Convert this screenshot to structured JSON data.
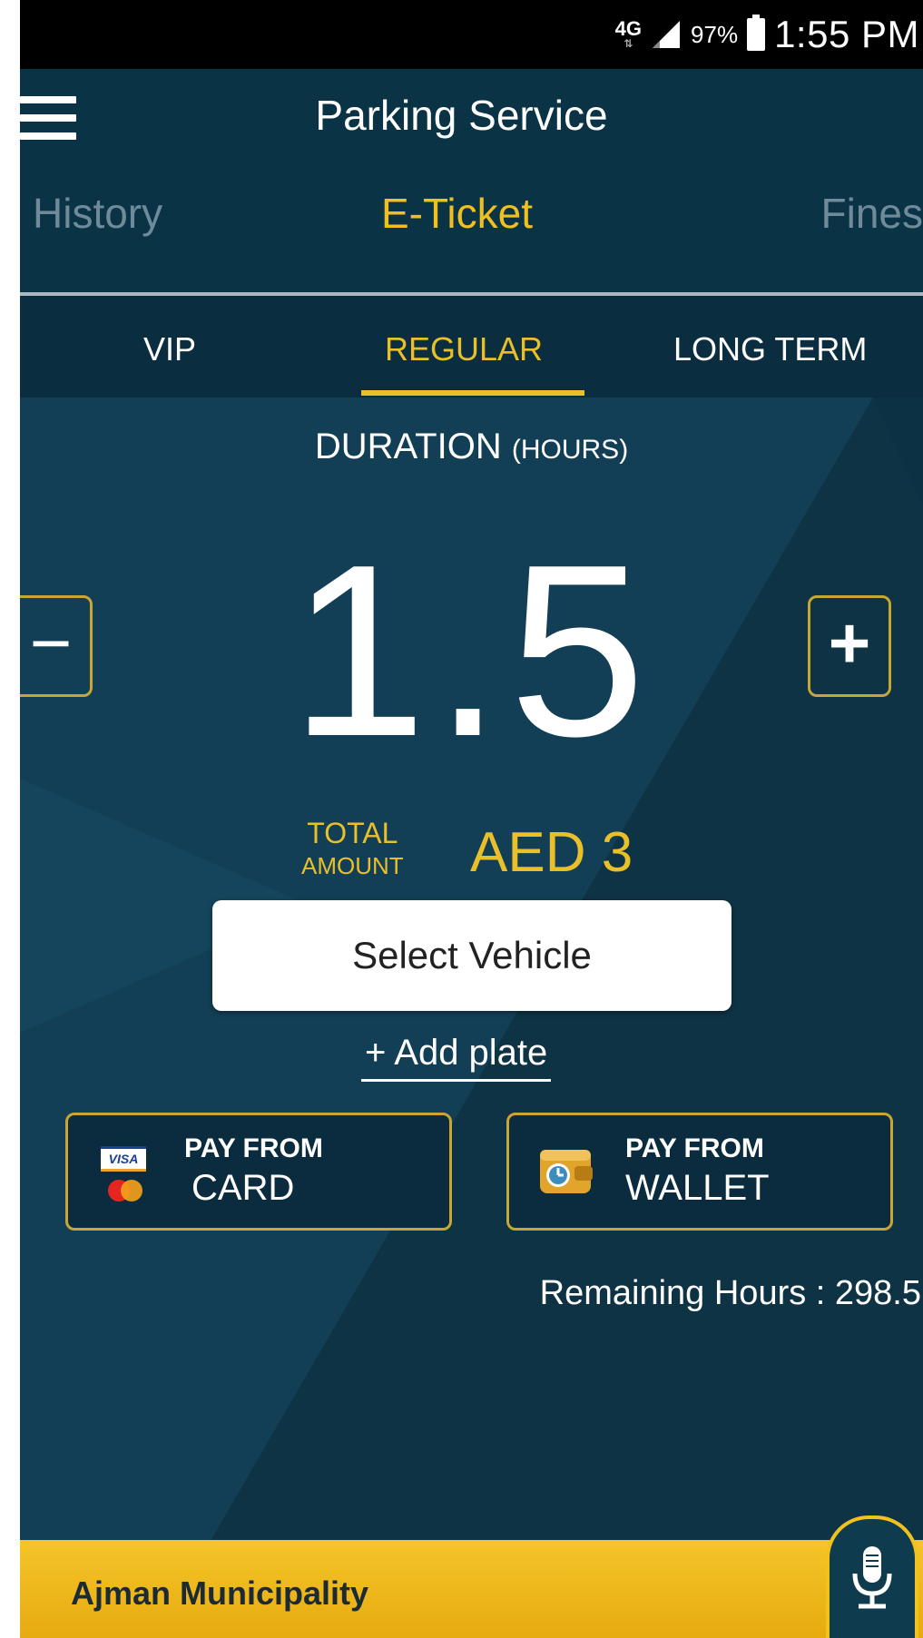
{
  "status_bar": {
    "network": "4G",
    "network_arrows": "⇅",
    "battery": "97%",
    "time": "1:55 PM"
  },
  "header": {
    "title": "Parking Service",
    "tabs": [
      {
        "label": "History",
        "active": false
      },
      {
        "label": "E-Ticket",
        "active": true
      },
      {
        "label": "Fines",
        "active": false
      }
    ]
  },
  "ticket_types": [
    {
      "label": "VIP",
      "active": false
    },
    {
      "label": "REGULAR",
      "active": true
    },
    {
      "label": "LONG TERM",
      "active": false
    }
  ],
  "duration": {
    "label": "DURATION",
    "unit": "(HOURS)",
    "value": "1.5",
    "decrement": "−",
    "increment": "+"
  },
  "total": {
    "label_line1": "TOTAL",
    "label_line2": "AMOUNT",
    "value": "AED 3"
  },
  "vehicle": {
    "select_label": "Select Vehicle",
    "add_plate": "+ Add plate"
  },
  "payment": {
    "card": {
      "line1": "PAY FROM",
      "line2": "CARD",
      "visa": "VISA"
    },
    "wallet": {
      "line1": "PAY FROM",
      "line2": "WALLET"
    }
  },
  "remaining_hours": "Remaining Hours : 298.5",
  "footer": {
    "label": "Ajman Municipality"
  },
  "colors": {
    "accent": "#e9bf2a",
    "background": "#0e3345",
    "footer": "#f1c21e"
  }
}
